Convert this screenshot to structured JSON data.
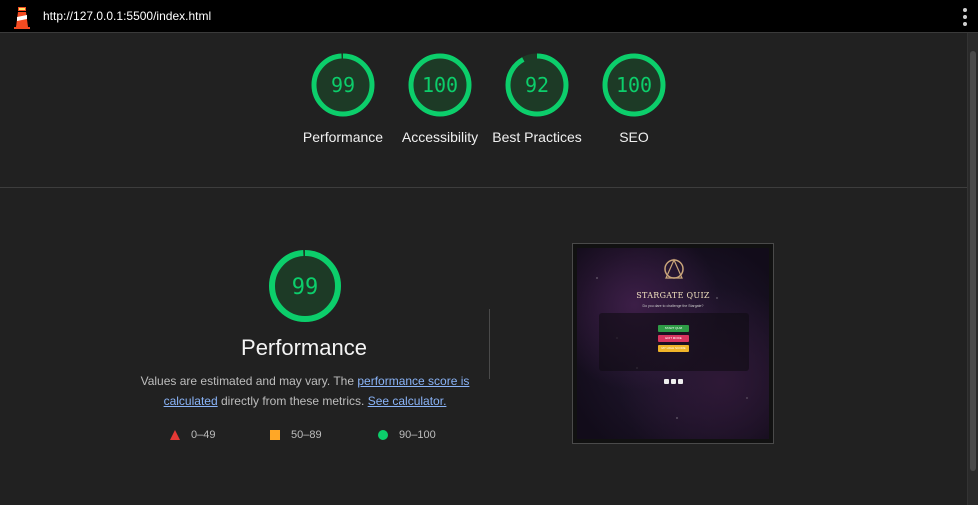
{
  "browser": {
    "url": "http://127.0.0.1:5500/index.html",
    "menu_icon": "kebab-menu-icon",
    "app_icon": "lighthouse-icon"
  },
  "scores": [
    {
      "value": "99",
      "fraction": 0.99,
      "label": "Performance"
    },
    {
      "value": "100",
      "fraction": 1.0,
      "label": "Accessibility"
    },
    {
      "value": "92",
      "fraction": 0.92,
      "label": "Best Practices"
    },
    {
      "value": "100",
      "fraction": 1.0,
      "label": "SEO"
    }
  ],
  "performance": {
    "score": "99",
    "fraction": 0.99,
    "title": "Performance",
    "desc_prefix": "Values are estimated and may vary. The ",
    "link_score": "performance score is calculated",
    "desc_middle": " directly from these metrics. ",
    "link_calculator": "See calculator."
  },
  "legend": [
    {
      "range": "0–49",
      "shape": "triangle",
      "color": "#e53935"
    },
    {
      "range": "50–89",
      "shape": "square",
      "color": "#ffa726"
    },
    {
      "range": "90–100",
      "shape": "circle",
      "color": "#0cce6b"
    }
  ],
  "screenshot": {
    "title": "STARGATE QUIZ",
    "subtitle": "Do you dare to challenge the Stargate?",
    "buttons": [
      {
        "label": "START QUIZ",
        "color": "#2e9b46"
      },
      {
        "label": "EDIT MODE",
        "color": "#d8345f"
      },
      {
        "label": "MY HIGH SCORE",
        "color": "#f0b429"
      }
    ],
    "social_icons": [
      "facebook-icon",
      "instagram-icon",
      "twitter-icon"
    ]
  },
  "colors": {
    "pass": "#0cce6b",
    "pass_bg": "#1d3a26",
    "background": "#212121"
  }
}
